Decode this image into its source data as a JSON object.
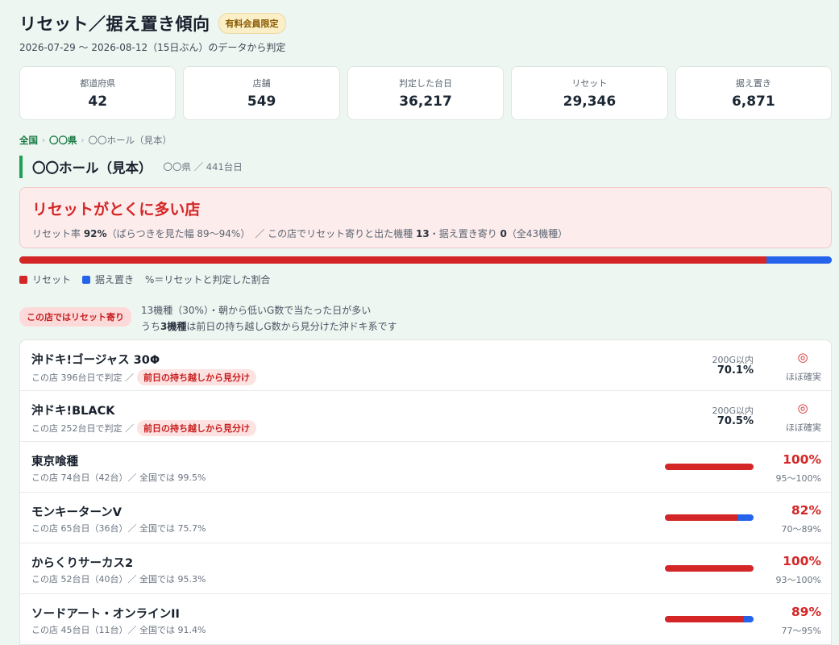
{
  "header": {
    "title": "リセット／据え置き傾向",
    "premium_badge": "有料会員限定",
    "subtitle": "2026-07-29 〜 2026-08-12（15日ぶん）のデータから判定"
  },
  "stats": [
    {
      "label": "都道府県",
      "value": "42"
    },
    {
      "label": "店舗",
      "value": "549"
    },
    {
      "label": "判定した台日",
      "value": "36,217"
    },
    {
      "label": "リセット",
      "value": "29,346"
    },
    {
      "label": "据え置き",
      "value": "6,871"
    }
  ],
  "breadcrumb": {
    "items": [
      "全国",
      "〇〇県",
      "〇〇ホール（見本）"
    ],
    "separator": "›"
  },
  "shop": {
    "name": "〇〇ホール（見本）",
    "meta": "〇〇県 ／ 441台日"
  },
  "verdict": {
    "title": "リセットがとくに多い店",
    "rate_prefix": "リセット率 ",
    "rate_value": "92%",
    "rate_range": "（ばらつきを見た幅 89〜94%）",
    "mid_text": "／ この店でリセット寄りと出た機種 ",
    "reset_count": "13",
    "mid_text2": "・据え置き寄り ",
    "hold_count": "0",
    "total_text": "（全43機種）"
  },
  "ratio": {
    "reset_fraction": 0.92
  },
  "legend": {
    "reset": "リセット",
    "hold": "据え置き",
    "note": "%＝リセットと判定した割合"
  },
  "colors": {
    "reset": "#d42626",
    "hold": "#2563eb",
    "accent": "#22a05a"
  },
  "lean": {
    "pill": "この店ではリセット寄り",
    "line1": "13機種（30%）・朝から低いG数で当たった日が多い",
    "line2_prefix": "うち",
    "line2_bold": "3機種",
    "line2_suffix": "は前日の持ち越しG数から見分けた沖ドキ系です"
  },
  "machines_special": [
    {
      "name": "沖ドキ!ゴージャス 30Φ",
      "meta": "この店 396台日で判定 ／",
      "tag": "前日の持ち越しから見分け",
      "g_label": "200G以内",
      "g_value": "70.1%",
      "mark": "◎",
      "mark_label": "ほぼ確実"
    },
    {
      "name": "沖ドキ!BLACK",
      "meta": "この店 252台日で判定 ／",
      "tag": "前日の持ち越しから見分け",
      "g_label": "200G以内",
      "g_value": "70.5%",
      "mark": "◎",
      "mark_label": "ほぼ確実"
    }
  ],
  "machines": [
    {
      "name": "東京喰種",
      "meta": "この店 74台日（42台）／ 全国では 99.5%",
      "reset_fraction": 1.0,
      "pct": "100%",
      "range": "95〜100%"
    },
    {
      "name": "モンキーターンV",
      "meta": "この店 65台日（36台）／ 全国では 75.7%",
      "reset_fraction": 0.82,
      "pct": "82%",
      "range": "70〜89%"
    },
    {
      "name": "からくりサーカス2",
      "meta": "この店 52台日（40台）／ 全国では 95.3%",
      "reset_fraction": 1.0,
      "pct": "100%",
      "range": "93〜100%"
    },
    {
      "name": "ソードアート・オンラインII",
      "meta": "この店 45台日（11台）／ 全国では 91.4%",
      "reset_fraction": 0.89,
      "pct": "89%",
      "range": "77〜95%"
    }
  ]
}
